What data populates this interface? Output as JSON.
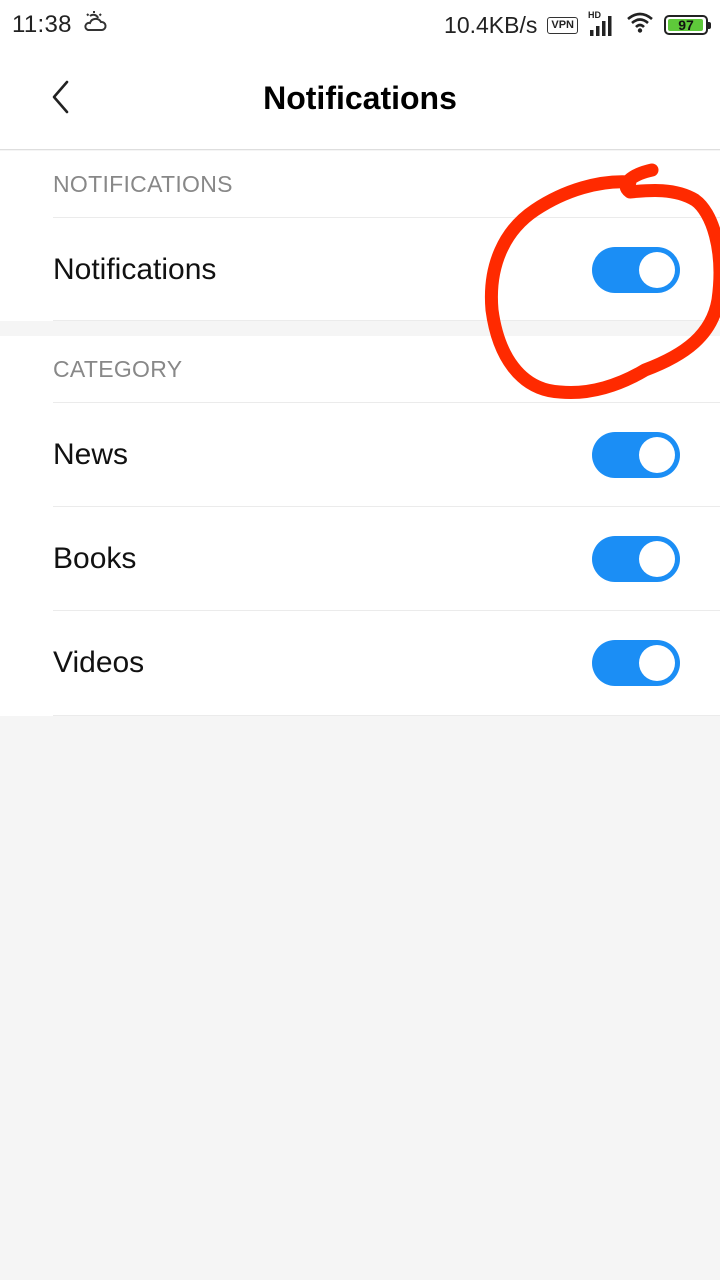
{
  "status_bar": {
    "time": "11:38",
    "network_speed": "10.4KB/s",
    "vpn_label": "VPN",
    "signal_label": "HD",
    "battery_level": "97",
    "battery_color": "#5ec93a",
    "icons": [
      "weather-icon",
      "vpn-icon",
      "signal-icon",
      "wifi-icon",
      "battery-icon"
    ]
  },
  "header": {
    "title": "Notifications",
    "back_icon": "chevron-left-icon"
  },
  "sections": [
    {
      "header": "NOTIFICATIONS",
      "rows": [
        {
          "label": "Notifications",
          "enabled": true
        }
      ]
    },
    {
      "header": "CATEGORY",
      "rows": [
        {
          "label": "News",
          "enabled": true
        },
        {
          "label": "Books",
          "enabled": true
        },
        {
          "label": "Videos",
          "enabled": true
        }
      ]
    }
  ],
  "colors": {
    "toggle_on": "#1b8ef5",
    "annotation": "#ff2a00"
  }
}
